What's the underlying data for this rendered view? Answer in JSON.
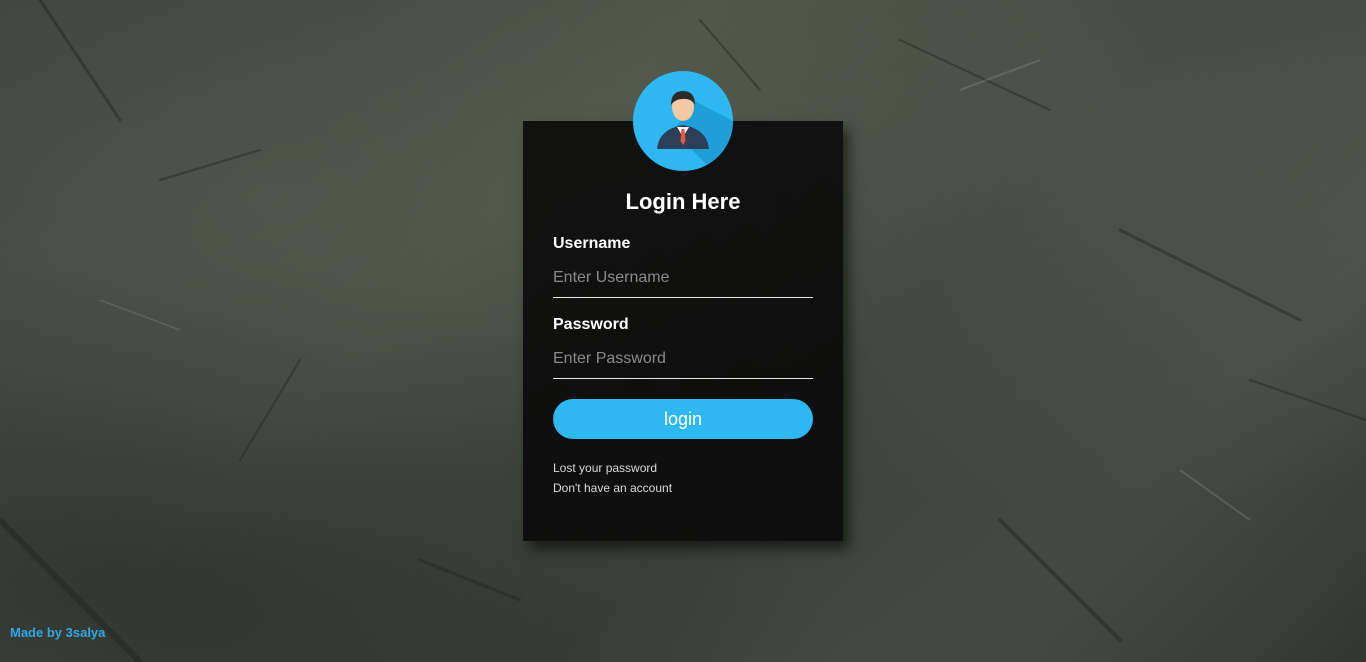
{
  "login": {
    "title": "Login Here",
    "username_label": "Username",
    "username_placeholder": "Enter Username",
    "username_value": "",
    "password_label": "Password",
    "password_placeholder": "Enter Password",
    "password_value": "",
    "submit_label": "login",
    "lost_password_link": "Lost your password",
    "no_account_link": "Don't have an account",
    "avatar_icon": "user-avatar-icon"
  },
  "footer": {
    "credit": "Made by 3salya"
  },
  "colors": {
    "accent": "#2eb8f2",
    "panel": "#080808",
    "footer_text": "#2ea8e6"
  }
}
